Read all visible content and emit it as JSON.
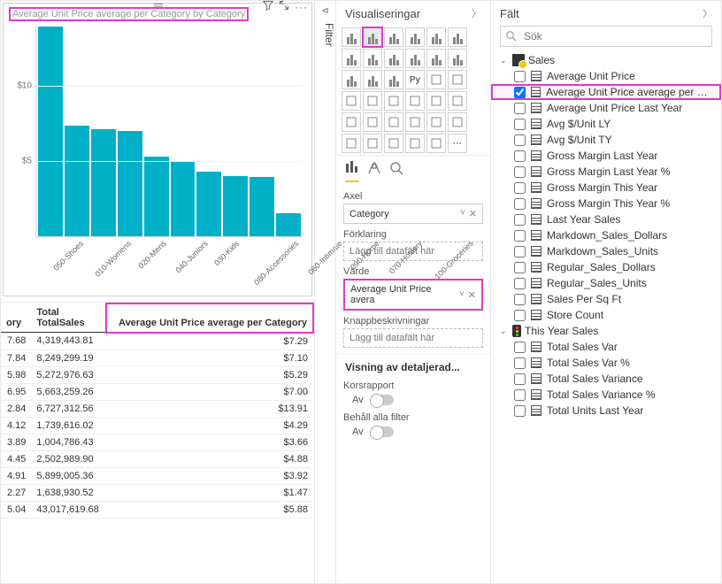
{
  "panes": {
    "viz_header": "Visualiseringar",
    "fields_header": "Fält",
    "filter_header": "Filter"
  },
  "search": {
    "placeholder": "Sök"
  },
  "visual": {
    "title": "Average Unit Price average per Category by Category"
  },
  "chart_data": {
    "type": "bar",
    "title": "Average Unit Price average per Category by Category",
    "xlabel": "",
    "ylabel": "",
    "ylim": [
      0,
      14
    ],
    "y_ticks": [
      5,
      10
    ],
    "y_tick_labels": [
      "$5",
      "$10"
    ],
    "categories": [
      "050-Shoes",
      "010-Womens",
      "020-Mens",
      "040-Juniors",
      "030-Kids",
      "080-Accessories",
      "060-Intimate",
      "090-Home",
      "070-Hosiery",
      "100-Groceries"
    ],
    "values": [
      13.9,
      7.3,
      7.1,
      7.0,
      5.3,
      4.9,
      4.3,
      4.0,
      3.9,
      1.5
    ]
  },
  "table": {
    "headers": {
      "col0": "ory",
      "col1": "Total\nTotalSales",
      "col2": "Average Unit Price average per Category"
    },
    "rows": [
      {
        "c0": "7.68",
        "c1": "4,319,443.81",
        "c2": "$7.29"
      },
      {
        "c0": "7.84",
        "c1": "8,249,299.19",
        "c2": "$7.10"
      },
      {
        "c0": "5.98",
        "c1": "5,272,976.63",
        "c2": "$5.29"
      },
      {
        "c0": "6.95",
        "c1": "5,663,259.26",
        "c2": "$7.00"
      },
      {
        "c0": "2.84",
        "c1": "6,727,312.56",
        "c2": "$13.91"
      },
      {
        "c0": "4.12",
        "c1": "1,739,616.02",
        "c2": "$4.29"
      },
      {
        "c0": "3.89",
        "c1": "1,004,786.43",
        "c2": "$3.66"
      },
      {
        "c0": "4.45",
        "c1": "2,502,989.90",
        "c2": "$4.88"
      },
      {
        "c0": "4.91",
        "c1": "5,899,005.36",
        "c2": "$3.92"
      },
      {
        "c0": "2.27",
        "c1": "1,638,930.52",
        "c2": "$1.47"
      },
      {
        "c0": "5.04",
        "c1": "43,017,619.68",
        "c2": "$5.88"
      }
    ]
  },
  "wells": {
    "axis_label": "Axel",
    "axis_value": "Category",
    "legend_label": "Förklaring",
    "legend_placeholder": "Lägg till datafält här",
    "value_label": "Värde",
    "value_value": "Average Unit Price avera",
    "tooltip_label": "Knappbeskrivningar",
    "tooltip_placeholder": "Lägg till datafält här"
  },
  "drill": {
    "header": "Visning av detaljerad...",
    "cross_label": "Korsrapport",
    "cross_state": "Av",
    "keep_label": "Behåll alla filter",
    "keep_state": "Av"
  },
  "field_tables": {
    "sales": {
      "name": "Sales",
      "fields": [
        {
          "label": "Average Unit Price",
          "checked": false,
          "hl": false
        },
        {
          "label": "Average Unit Price average per Cate...",
          "checked": true,
          "hl": true
        },
        {
          "label": "Average Unit Price Last Year",
          "checked": false,
          "hl": false
        },
        {
          "label": "Avg $/Unit LY",
          "checked": false,
          "hl": false
        },
        {
          "label": "Avg $/Unit TY",
          "checked": false,
          "hl": false
        },
        {
          "label": "Gross Margin Last Year",
          "checked": false,
          "hl": false
        },
        {
          "label": "Gross Margin Last Year %",
          "checked": false,
          "hl": false
        },
        {
          "label": "Gross Margin This Year",
          "checked": false,
          "hl": false
        },
        {
          "label": "Gross Margin This Year %",
          "checked": false,
          "hl": false
        },
        {
          "label": "Last Year Sales",
          "checked": false,
          "hl": false
        },
        {
          "label": "Markdown_Sales_Dollars",
          "checked": false,
          "hl": false
        },
        {
          "label": "Markdown_Sales_Units",
          "checked": false,
          "hl": false
        },
        {
          "label": "Regular_Sales_Dollars",
          "checked": false,
          "hl": false
        },
        {
          "label": "Regular_Sales_Units",
          "checked": false,
          "hl": false
        },
        {
          "label": "Sales Per Sq Ft",
          "checked": false,
          "hl": false
        },
        {
          "label": "Store Count",
          "checked": false,
          "hl": false
        }
      ]
    },
    "this_year": {
      "name": "This Year Sales",
      "fields": [
        {
          "label": "Total Sales Var",
          "checked": false,
          "hl": false
        },
        {
          "label": "Total Sales Var %",
          "checked": false,
          "hl": false
        },
        {
          "label": "Total Sales Variance",
          "checked": false,
          "hl": false
        },
        {
          "label": "Total Sales Variance %",
          "checked": false,
          "hl": false
        },
        {
          "label": "Total Units Last Year",
          "checked": false,
          "hl": false
        }
      ]
    }
  },
  "viz_icons": [
    "bar",
    "col",
    "line",
    "area",
    "stack",
    "pie",
    "donut",
    "map",
    "tree",
    "funnel",
    "gauge",
    "card",
    "matrix",
    "table",
    "R",
    "Py",
    "kpi",
    "slicer",
    "arc",
    "globe",
    "qa",
    "more1",
    "more2",
    "more3",
    "more4",
    "more5",
    "more6",
    "more7",
    "more8",
    "more9",
    "more10",
    "more11",
    "more12",
    "more13",
    "more14"
  ]
}
